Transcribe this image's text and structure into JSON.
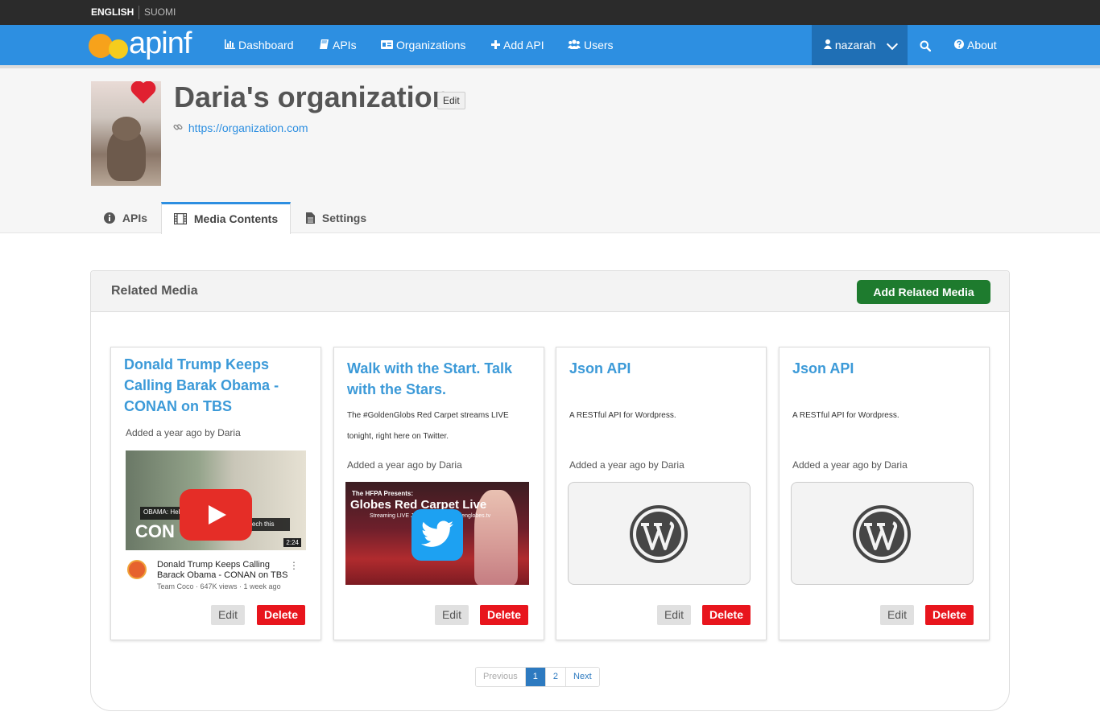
{
  "languages": {
    "english": "ENGLISH",
    "suomi": "SUOMI"
  },
  "brand": {
    "logo_text": "apinf"
  },
  "nav": {
    "dashboard": "Dashboard",
    "apis": "APIs",
    "organizations": "Organizations",
    "add_api": "Add API",
    "users": "Users",
    "user": "nazarah",
    "about": "About"
  },
  "org": {
    "title": "Daria's organization",
    "edit_label": "Edit",
    "url": "https://organization.com"
  },
  "tabs": [
    {
      "label": "APIs"
    },
    {
      "label": "Media Contents"
    },
    {
      "label": "Settings"
    }
  ],
  "panel": {
    "title": "Related Media",
    "add_label": "Add Related Media"
  },
  "cards": [
    {
      "title": "Donald Trump Keeps Calling Barak Obama -  CONAN on TBS",
      "meta": "Added a year ago by Daria",
      "edit": "Edit",
      "delete": "Delete",
      "video": {
        "caption": "OBAMA: Hello?",
        "caption2": "speech this",
        "big_text": "CON",
        "duration": "2:24",
        "title": "Donald Trump Keeps Calling Barack Obama  - CONAN on TBS",
        "stats": "Team Coco · 647K views · 1 week ago"
      }
    },
    {
      "title": "Walk with the Start. Talk with the Stars.",
      "desc": "The #GoldenGlobs Red Carpet streams LIVE tonight, right here on Twitter.",
      "meta": "Added a year ago by Daria",
      "edit": "Edit",
      "delete": "Delete",
      "thumb": {
        "line1": "The HFPA Presents:",
        "line2": "Globes Red Carpet Live",
        "line3": "Streaming LIVE Jan. 8, 6PM ET goldenglobes.tv"
      }
    },
    {
      "title": "Json API",
      "desc": "A  RESTful API for Wordpress.",
      "meta": "Added a year ago by Daria",
      "edit": "Edit",
      "delete": "Delete"
    },
    {
      "title": "Json API",
      "desc": "A  RESTful API for Wordpress.",
      "meta": "Added a year ago by Daria",
      "edit": "Edit",
      "delete": "Delete"
    }
  ],
  "pagination": {
    "previous": "Previous",
    "pages": [
      "1",
      "2"
    ],
    "next": "Next",
    "current": "1"
  },
  "icons": {
    "dashboard": "bar-chart-icon",
    "apis": "book-icon",
    "organizations": "id-card-icon",
    "add_api": "plus-icon",
    "users": "users-icon",
    "user": "user-icon",
    "search": "search-icon",
    "about": "question-circle-icon",
    "link": "link-icon",
    "info": "info-circle-icon",
    "film": "film-icon",
    "file": "file-icon"
  },
  "colors": {
    "nav_blue": "#2d8fe1",
    "user_blue": "#1f6fb5",
    "add_green": "#1e7b2e",
    "delete_red": "#e8151d",
    "title_blue": "#3c9ad8"
  }
}
